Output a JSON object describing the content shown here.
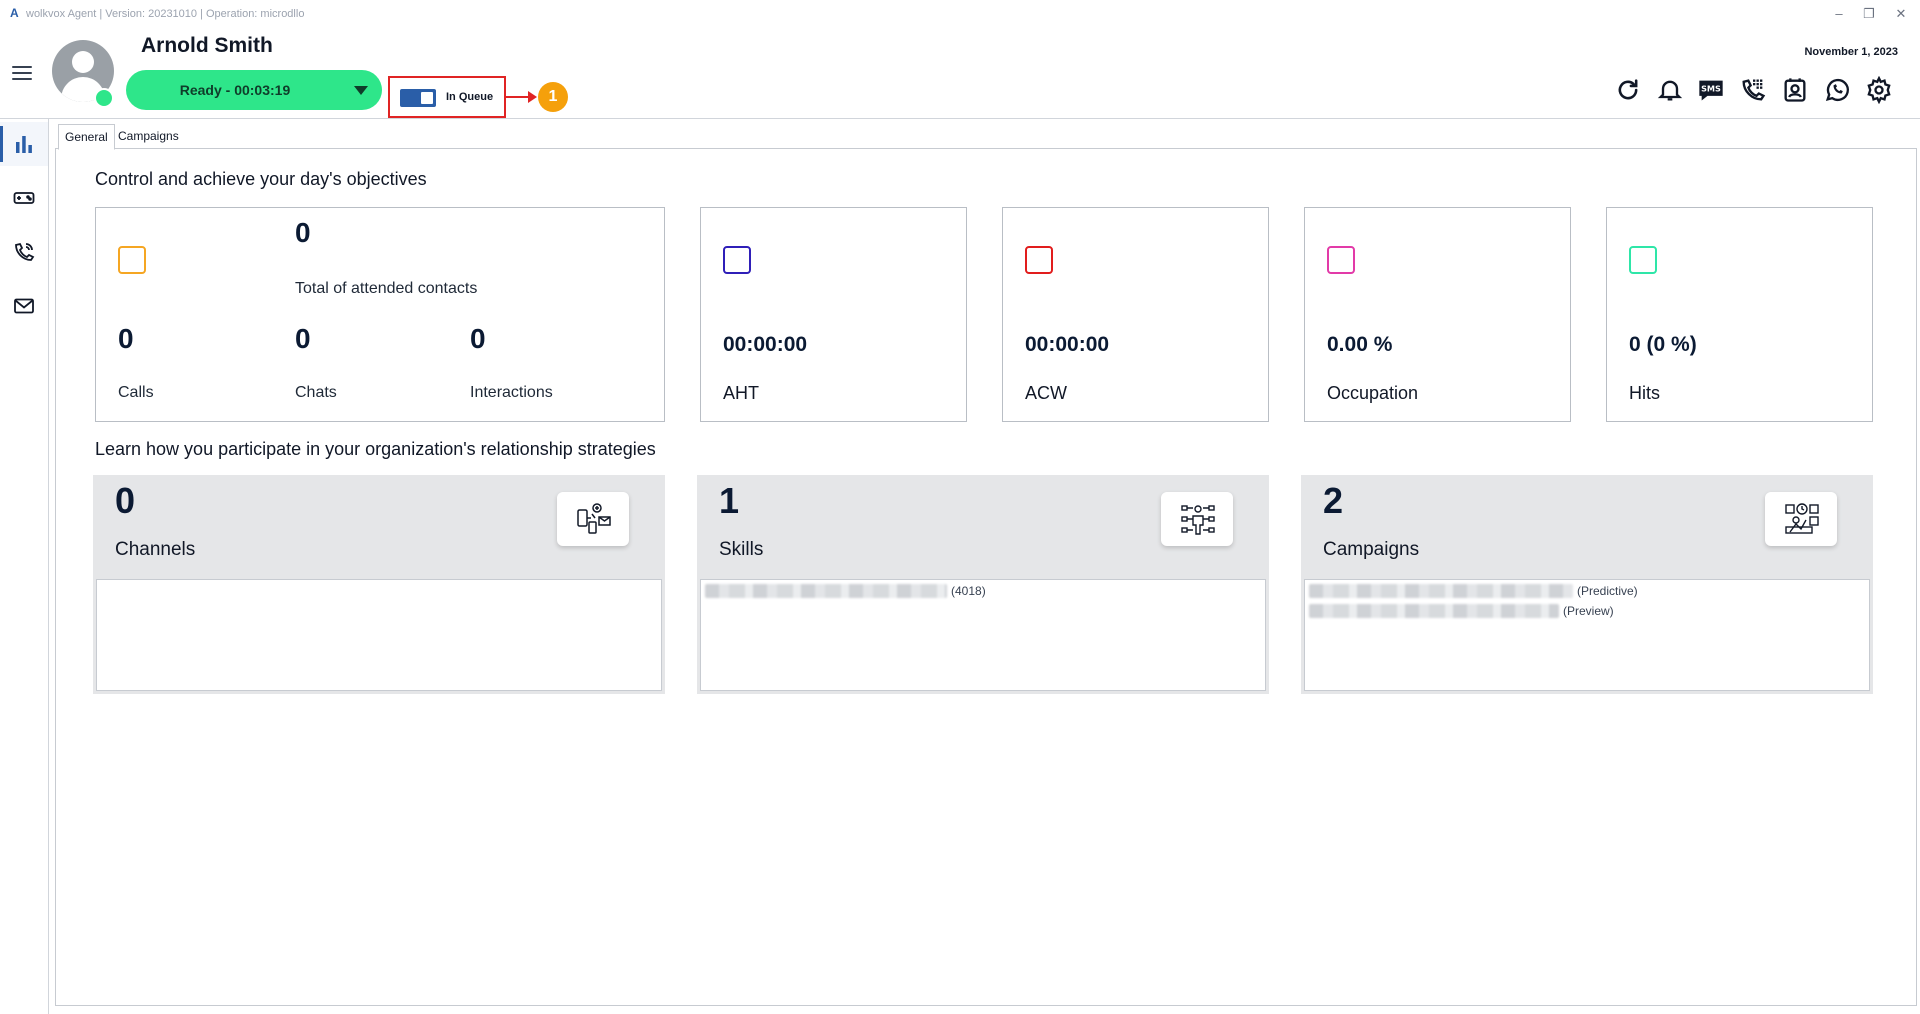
{
  "window": {
    "title": "wolkvox Agent | Version: 20231010 | Operation: microdllo",
    "logo": "A"
  },
  "header": {
    "agent_name": "Arnold Smith",
    "status_label": "Ready - 00:03:19",
    "queue_label": "In Queue",
    "queue_toggle_on": true,
    "annotation_number": "1",
    "date": "November 1, 2023",
    "icons": [
      "refresh-icon",
      "bell-icon",
      "sms-icon",
      "dialpad-phone-icon",
      "contacts-icon",
      "whatsapp-icon",
      "settings-icon"
    ]
  },
  "sidebar": {
    "items": [
      {
        "name": "stats-icon",
        "active": true
      },
      {
        "name": "gamepad-icon",
        "active": false
      },
      {
        "name": "phone-icon",
        "active": false
      },
      {
        "name": "mail-icon",
        "active": false
      }
    ]
  },
  "tabs": [
    "General",
    "Campaigns"
  ],
  "objectives": {
    "title": "Control and achieve your day's objectives",
    "contacts": {
      "total": "0",
      "total_label": "Total of attended contacts",
      "calls": "0",
      "calls_label": "Calls",
      "chats": "0",
      "chats_label": "Chats",
      "interactions": "0",
      "interactions_label": "Interactions"
    },
    "aht": {
      "value": "00:00:00",
      "label": "AHT"
    },
    "acw": {
      "value": "00:00:00",
      "label": "ACW"
    },
    "occupation": {
      "value": "0.00 %",
      "label": "Occupation"
    },
    "hits": {
      "value": "0 (0 %)",
      "label": "Hits"
    },
    "colors": {
      "contacts": "#f5a623",
      "aht": "#2f1fb8",
      "acw": "#e11d1d",
      "occupation": "#e23aa8",
      "hits": "#2ee6a8"
    }
  },
  "strategies": {
    "title": "Learn how you participate in your organization's relationship strategies",
    "channels": {
      "count": "0",
      "label": "Channels"
    },
    "skills": {
      "count": "1",
      "label": "Skills",
      "items": [
        {
          "tag": "(4018)"
        }
      ]
    },
    "campaigns": {
      "count": "2",
      "label": "Campaigns",
      "items": [
        {
          "tag": "(Predictive)"
        },
        {
          "tag": "(Preview)"
        }
      ]
    }
  }
}
